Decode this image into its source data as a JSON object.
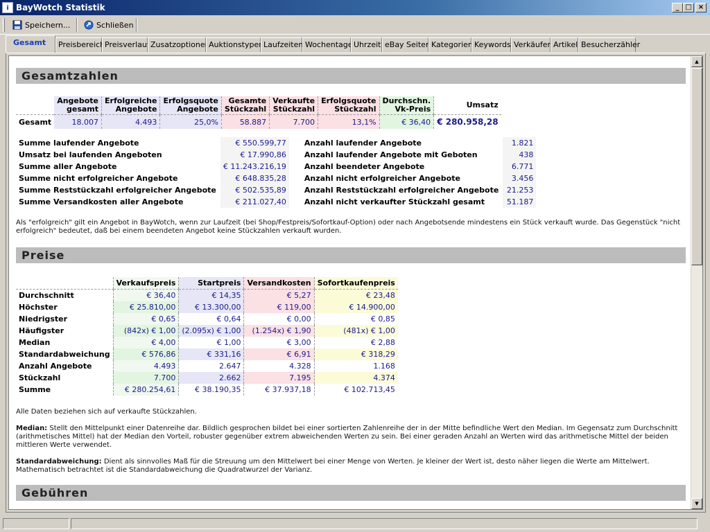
{
  "window": {
    "title": "BayWotch Statistik"
  },
  "toolbar": {
    "save": "Speichern...",
    "close": "Schließen"
  },
  "tabs": [
    "Gesamt",
    "Preisbereich",
    "Preisverlauf",
    "Zusatzoptionen",
    "Auktionstypen",
    "Laufzeiten",
    "Wochentage",
    "Uhrzeit",
    "eBay Seiten",
    "Kategorien",
    "Keywords",
    "Verkäufer",
    "Artikel",
    "Besucherzähler"
  ],
  "sections": {
    "gesamt": "Gesamtzahlen",
    "preise": "Preise",
    "gebuehren": "Gebühren"
  },
  "gesamt_table": {
    "headers": [
      [
        "Angebote",
        "gesamt"
      ],
      [
        "Erfolgreiche",
        "Angebote"
      ],
      [
        "Erfolgsquote",
        "Angebote"
      ],
      [
        "Gesamte",
        "Stückzahl"
      ],
      [
        "Verkaufte",
        "Stückzahl"
      ],
      [
        "Erfolgsquote",
        "Stückzahl"
      ],
      [
        "Durchschn.",
        "Vk-Preis"
      ],
      [
        "Umsatz",
        ""
      ]
    ],
    "row_label": "Gesamt",
    "values": [
      "18.007",
      "4.493",
      "25,0%",
      "58.887",
      "7.700",
      "13,1%",
      "€ 36,40",
      "€ 280.958,28"
    ]
  },
  "sums_left": [
    {
      "label": "Summe laufender Angebote",
      "value": "€ 550.599,77"
    },
    {
      "label": "Umsatz bei laufenden Angeboten",
      "value": "€ 17.990,86"
    },
    {
      "label": "Summe aller Angebote",
      "value": "€ 11.243.216,19"
    },
    {
      "label": "Summe nicht erfolgreicher Angebote",
      "value": "€ 648.835,28"
    },
    {
      "label": "Summe Reststückzahl erfolgreicher Angebote",
      "value": "€ 502.535,89"
    },
    {
      "label": "Summe Versandkosten aller Angebote",
      "value": "€ 211.027,40"
    }
  ],
  "sums_right": [
    {
      "label": "Anzahl laufender Angebote",
      "value": "1.821"
    },
    {
      "label": "Anzahl laufender Angebote mit Geboten",
      "value": "438"
    },
    {
      "label": "Anzahl beendeter Angebote",
      "value": "6.771"
    },
    {
      "label": "Anzahl nicht erfolgreicher Angebote",
      "value": "3.456"
    },
    {
      "label": "Anzahl Reststückzahl erfolgreicher Angebote",
      "value": "21.253"
    },
    {
      "label": "Anzahl nicht verkaufter Stückzahl gesamt",
      "value": "51.187"
    }
  ],
  "note_gesamt": "Als \"erfolgreich\" gilt ein Angebot in BayWotch, wenn zur Laufzeit (bei Shop/Festpreis/Sofortkauf-Option) oder nach Angebotsende mindestens ein Stück verkauft wurde. Das Gegenstück \"nicht erfolgreich\" bedeutet, daß bei einem beendeten Angebot keine Stückzahlen verkauft wurden.",
  "preise_table": {
    "headers": [
      "Verkaufspreis",
      "Startpreis",
      "Versandkosten",
      "Sofortkaufenpreis"
    ],
    "rows": [
      {
        "label": "Durchschnitt",
        "values": [
          "€ 36,40",
          "€ 14,35",
          "€ 5,27",
          "€ 23,48"
        ]
      },
      {
        "label": "Höchster",
        "values": [
          "€ 25.810,00",
          "€ 13.300,00",
          "€ 119,00",
          "€ 14.900,00"
        ]
      },
      {
        "label": "Niedrigster",
        "values": [
          "€ 0,65",
          "€ 0,64",
          "€ 0,00",
          "€ 0,85"
        ]
      },
      {
        "label": "Häufigster",
        "values": [
          "(842x) € 1,00",
          "(2.095x) € 1,00",
          "(1.254x) € 1,90",
          "(481x) € 1,00"
        ]
      },
      {
        "label": "Median",
        "values": [
          "€ 4,00",
          "€ 1,00",
          "€ 3,00",
          "€ 2,88"
        ]
      },
      {
        "label": "Standardabweichung",
        "values": [
          "€ 576,86",
          "€ 331,16",
          "€ 6,91",
          "€ 318,29"
        ]
      },
      {
        "label": "Anzahl Angebote",
        "values": [
          "4.493",
          "2.647",
          "4.328",
          "1.168"
        ]
      },
      {
        "label": "Stückzahl",
        "values": [
          "7.700",
          "2.662",
          "7.195",
          "4.374"
        ]
      },
      {
        "label": "Summe",
        "values": [
          "€ 280.254,61",
          "€ 38.190,35",
          "€ 37.937,18",
          "€ 102.713,45"
        ]
      }
    ]
  },
  "note_preise": "Alle Daten beziehen sich auf verkaufte Stückzahlen.",
  "median_label": "Median:",
  "median_text": " Stellt den Mittelpunkt einer Datenreihe dar. Bildlich gesprochen bildet bei einer sortierten Zahlenreihe der in der Mitte befindliche Wert den Median. Im Gegensatz zum Durchschnitt (arithmetisches Mittel) hat der Median den Vorteil, robuster gegenüber extrem abweichenden Werten zu sein. Bei einer geraden Anzahl an Werten wird das arithmetische Mittel der beiden mittleren Werte verwendet.",
  "std_label": "Standardabweichung:",
  "std_text": " Dient als sinnvolles Maß für die Streuung um den Mittelwert bei einer Menge von Werten. Je kleiner der Wert ist, desto näher liegen die Werte am Mittelwert. Mathematisch betrachtet ist die Standardabweichung die Quadratwurzel der Varianz."
}
